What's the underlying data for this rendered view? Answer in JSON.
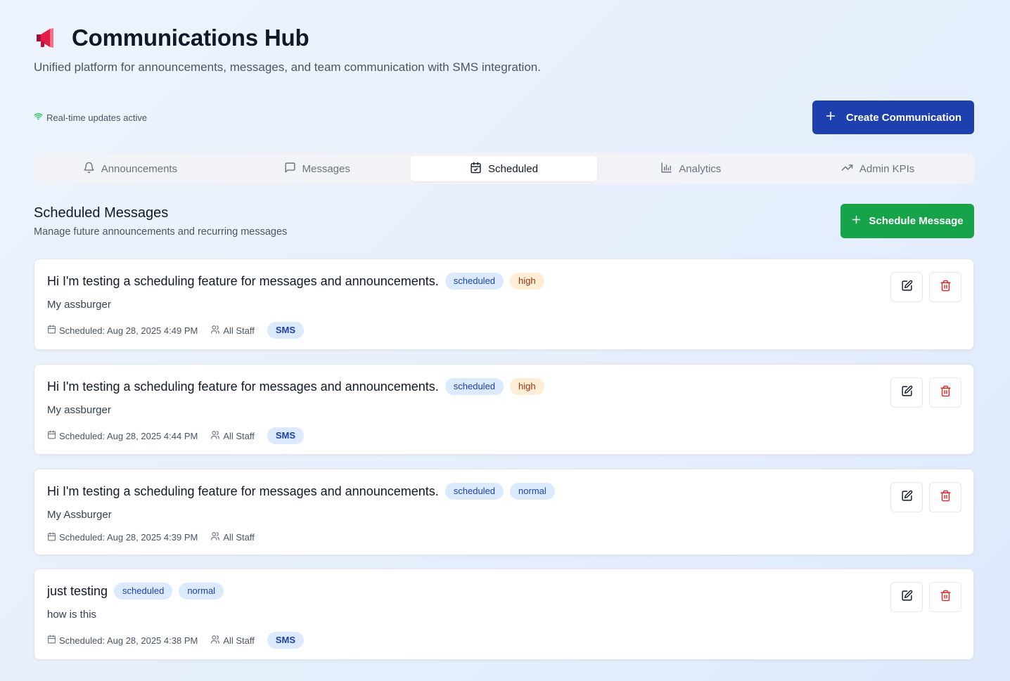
{
  "header": {
    "icon": "megaphone-icon",
    "title": "Communications Hub",
    "subtitle": "Unified platform for announcements, messages, and team communication with SMS integration."
  },
  "status": {
    "realtime_label": "Real-time updates active",
    "color": "#22c55e"
  },
  "actions": {
    "create_label": "Create Communication",
    "create_color": "#1e40af"
  },
  "tabs": [
    {
      "label": "Announcements",
      "icon": "bell-icon",
      "active": false
    },
    {
      "label": "Messages",
      "icon": "message-square-icon",
      "active": false
    },
    {
      "label": "Scheduled",
      "icon": "calendar-check-icon",
      "active": true
    },
    {
      "label": "Analytics",
      "icon": "bar-chart-icon",
      "active": false
    },
    {
      "label": "Admin KPIs",
      "icon": "trending-up-icon",
      "active": false
    }
  ],
  "scheduled": {
    "title": "Scheduled Messages",
    "subtitle": "Manage future announcements and recurring messages",
    "schedule_label": "Schedule Message",
    "schedule_color": "#16a34a",
    "items": [
      {
        "title": "Hi I'm testing a scheduling feature for messages and announcements.",
        "status": "scheduled",
        "priority": "high",
        "body": "My assburger",
        "scheduled": "Scheduled: Aug 28, 2025 4:49 PM",
        "audience": "All Staff",
        "channel": "SMS"
      },
      {
        "title": "Hi I'm testing a scheduling feature for messages and announcements.",
        "status": "scheduled",
        "priority": "high",
        "body": "My assburger",
        "scheduled": "Scheduled: Aug 28, 2025 4:44 PM",
        "audience": "All Staff",
        "channel": "SMS"
      },
      {
        "title": "Hi I'm testing a scheduling feature for messages and announcements.",
        "status": "scheduled",
        "priority": "normal",
        "body": "My Assburger",
        "scheduled": "Scheduled: Aug 28, 2025 4:39 PM",
        "audience": "All Staff",
        "channel": ""
      },
      {
        "title": "just testing",
        "status": "scheduled",
        "priority": "normal",
        "body": "how is this",
        "scheduled": "Scheduled: Aug 28, 2025 4:38 PM",
        "audience": "All Staff",
        "channel": "SMS"
      }
    ]
  }
}
